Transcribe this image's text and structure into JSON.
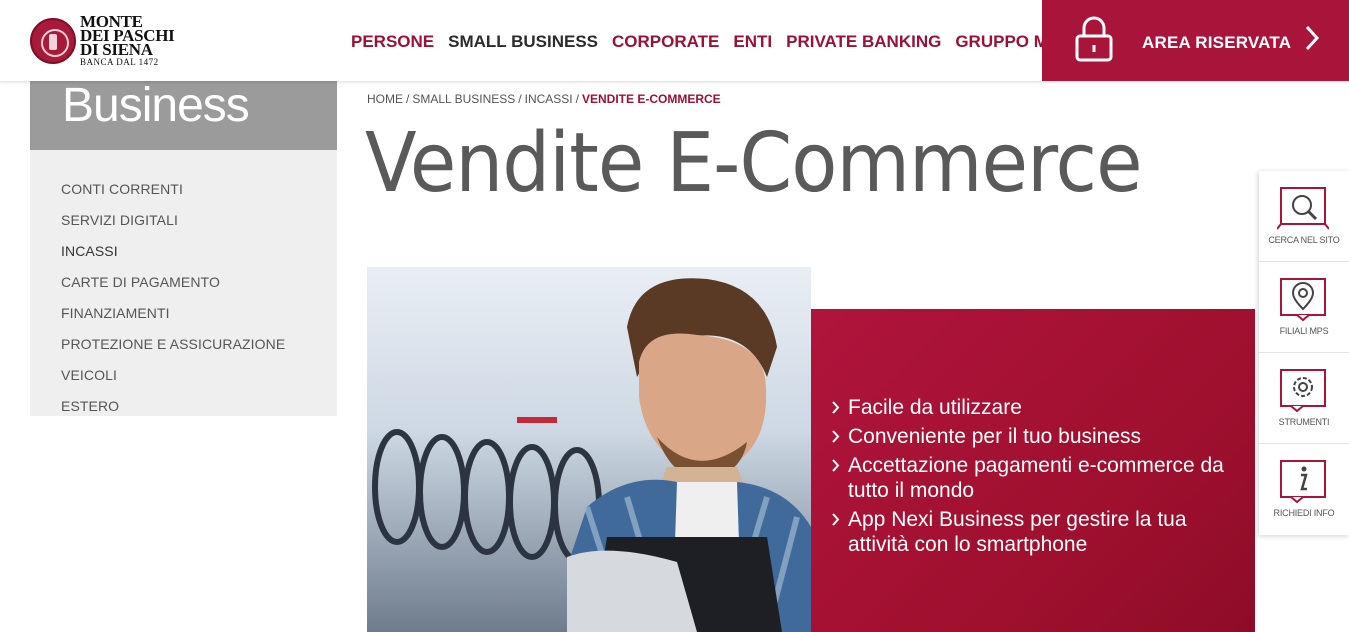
{
  "brand": {
    "name_line1": "MONTE",
    "name_line2": "DEI PASCHI",
    "name_line3": "DI SIENA",
    "tagline": "BANCA DAL 1472",
    "accent_color": "#a8143a"
  },
  "nav": {
    "items": [
      {
        "label": "PERSONE"
      },
      {
        "label": "SMALL BUSINESS"
      },
      {
        "label": "CORPORATE"
      },
      {
        "label": "ENTI"
      },
      {
        "label": "PRIVATE BANKING"
      },
      {
        "label": "GRUPPO MPS"
      }
    ],
    "area_riservata": "AREA RISERVATA"
  },
  "sidebar": {
    "title": "Business",
    "items": [
      {
        "label": "CONTI CORRENTI"
      },
      {
        "label": "SERVIZI DIGITALI"
      },
      {
        "label": "INCASSI"
      },
      {
        "label": "CARTE DI PAGAMENTO"
      },
      {
        "label": "FINANZIAMENTI"
      },
      {
        "label": "PROTEZIONE E ASSICURAZIONE VEICOLI"
      },
      {
        "label": "ESTERO"
      }
    ]
  },
  "breadcrumb": {
    "items": [
      "HOME",
      "SMALL BUSINESS",
      "INCASSI"
    ],
    "current": "VENDITE E-COMMERCE"
  },
  "page": {
    "title": "Vendite E-Commerce"
  },
  "features": [
    "Facile da utilizzare",
    "Conveniente per il tuo business",
    "Accettazione pagamenti e-commerce da tutto il mondo",
    "App Nexi Business per gestire la tua attività con lo smartphone"
  ],
  "tools": [
    {
      "label": "CERCA NEL SITO",
      "icon": "search-icon"
    },
    {
      "label": "FILIALI MPS",
      "icon": "map-pin-icon"
    },
    {
      "label": "STRUMENTI",
      "icon": "gear-icon"
    },
    {
      "label": "RICHIEDI INFO",
      "icon": "info-icon"
    }
  ]
}
